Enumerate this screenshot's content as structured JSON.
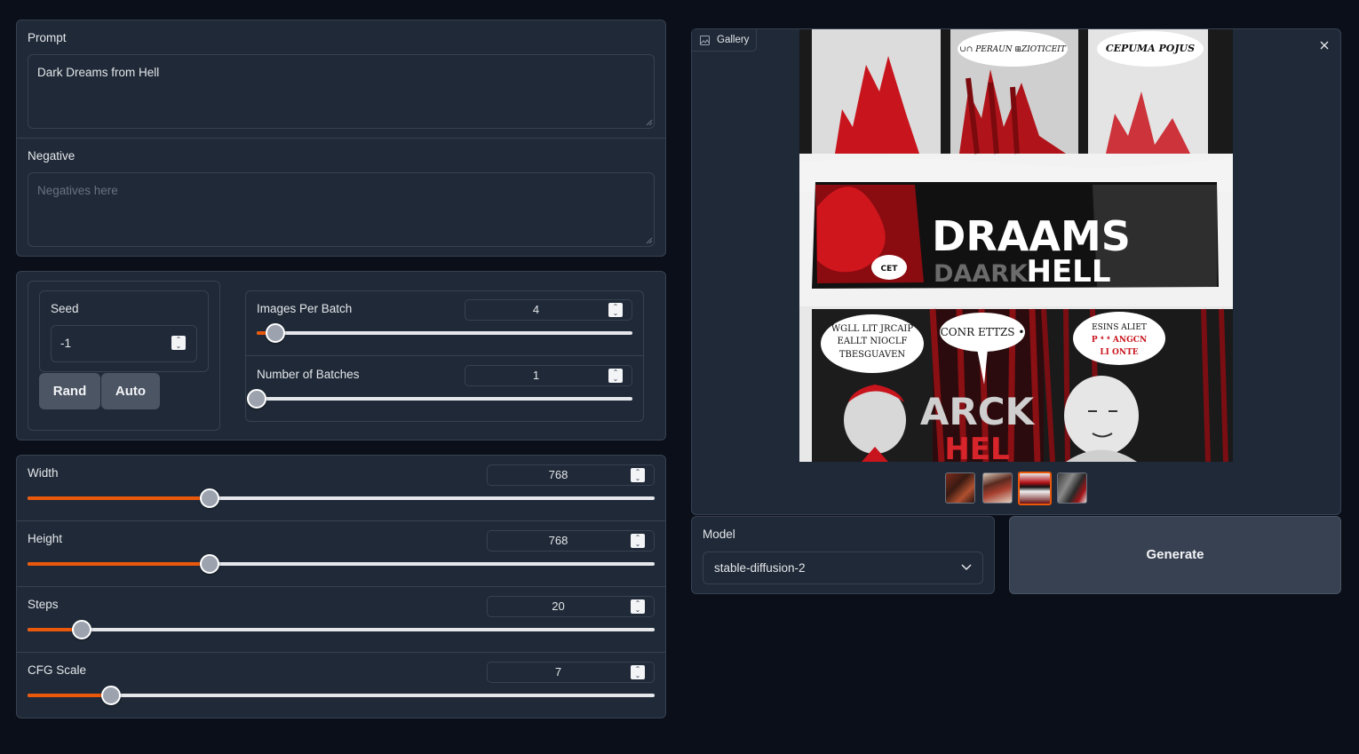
{
  "prompt": {
    "label": "Prompt",
    "value": "Dark Dreams from Hell"
  },
  "negative": {
    "label": "Negative",
    "placeholder": "Negatives here"
  },
  "seed": {
    "label": "Seed",
    "value": "-1",
    "rand_label": "Rand",
    "auto_label": "Auto"
  },
  "images_per_batch": {
    "label": "Images Per Batch",
    "value": "4",
    "fraction": 0.05
  },
  "number_of_batches": {
    "label": "Number of Batches",
    "value": "1",
    "fraction": 0.0
  },
  "width": {
    "label": "Width",
    "value": "768",
    "fraction": 0.29
  },
  "height": {
    "label": "Height",
    "value": "768",
    "fraction": 0.29
  },
  "steps": {
    "label": "Steps",
    "value": "20",
    "fraction": 0.087
  },
  "cfg_scale": {
    "label": "CFG Scale",
    "value": "7",
    "fraction": 0.133
  },
  "gallery": {
    "label": "Gallery",
    "main_image": {
      "top_bubble_left": "∪∩ PERAUN ⊞ZIOTICEIT",
      "top_bubble_right": "CEPUMA POJUS",
      "title_big": "DRAAMS",
      "title_sub": "DAARK",
      "title_hell": "HELL",
      "small_bubble": "CET",
      "panel_text_left_1": "WGLL LIT JRCAIP",
      "panel_text_left_2": "EALLT NIOCLF",
      "panel_text_left_3": "TBESGUAVEN",
      "speech_middle": "CONR ETTZS •",
      "middle_big_1": "ARCK",
      "middle_big_2": "HEL",
      "panel_text_right_1": "ESINS ALIET",
      "panel_text_right_2": "P ⁴ ⁴ ANGCN",
      "panel_text_right_3": "LI ONTE"
    },
    "selected_thumb": 2
  },
  "model": {
    "label": "Model",
    "value": "stable-diffusion-2"
  },
  "generate": {
    "label": "Generate"
  },
  "colors": {
    "accent": "#ea580c",
    "panel": "#1f2937",
    "background": "#0b0f19"
  }
}
